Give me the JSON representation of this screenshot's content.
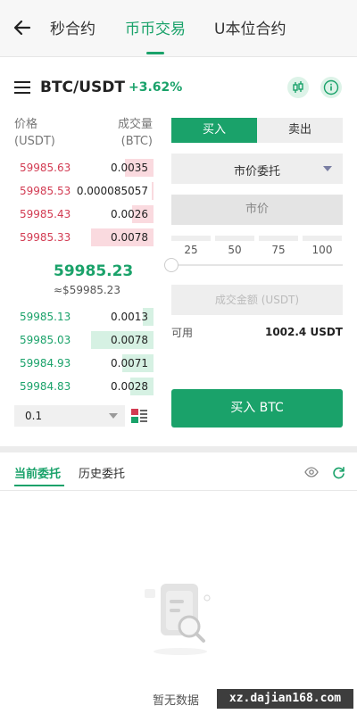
{
  "nav": {
    "tabs": [
      {
        "label": "秒合约"
      },
      {
        "label": "币币交易"
      },
      {
        "label": "U本位合约"
      }
    ]
  },
  "pair": {
    "symbol": "BTC/USDT",
    "change": "+3.62%"
  },
  "orderbook": {
    "price_header": [
      "价格",
      "(USDT)"
    ],
    "qty_header": [
      "成交量",
      "(BTC)"
    ],
    "asks": [
      {
        "price": "59985.63",
        "qty": "0.0035",
        "depth": 0.45
      },
      {
        "price": "59985.53",
        "qty": "0.000085057",
        "depth": 0.01
      },
      {
        "price": "59985.43",
        "qty": "0.0026",
        "depth": 0.34
      },
      {
        "price": "59985.33",
        "qty": "0.0078",
        "depth": 1.0
      }
    ],
    "last_price": "59985.23",
    "last_price_usd": "≈$59985.23",
    "bids": [
      {
        "price": "59985.13",
        "qty": "0.0013",
        "depth": 0.17
      },
      {
        "price": "59985.03",
        "qty": "0.0078",
        "depth": 1.0
      },
      {
        "price": "59984.93",
        "qty": "0.0071",
        "depth": 0.5
      },
      {
        "price": "59984.83",
        "qty": "0.0028",
        "depth": 0.37
      }
    ],
    "depth_select": "0.1"
  },
  "form": {
    "buy_tab": "买入",
    "sell_tab": "卖出",
    "order_type": "市价委托",
    "price_placeholder": "市价",
    "percents": [
      "25",
      "50",
      "75",
      "100"
    ],
    "slider_value": 0,
    "amount_placeholder": "成交金额 (USDT)",
    "available_label": "可用",
    "available_value": "1002.4 USDT",
    "submit_label": "买入 BTC"
  },
  "orders": {
    "tabs": [
      {
        "label": "当前委托"
      },
      {
        "label": "历史委托"
      }
    ],
    "empty_text": "暂无数据"
  },
  "watermark": "xz.dajian168.com",
  "colors": {
    "accent_green": "#1aa26a",
    "ask_red": "#d23b52"
  }
}
